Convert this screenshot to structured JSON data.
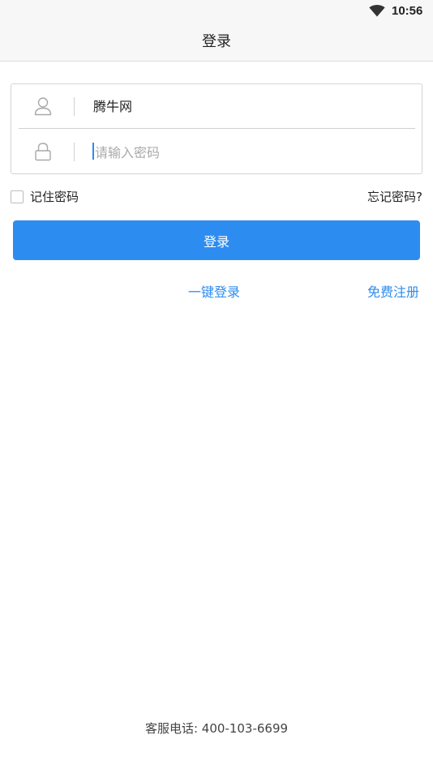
{
  "status_bar": {
    "time": "10:56",
    "wifi_icon": "wifi-icon"
  },
  "header": {
    "title": "登录"
  },
  "form": {
    "username_icon": "user-icon",
    "username_value": "腾牛网",
    "password_icon": "lock-icon",
    "password_placeholder": "请输入密码",
    "password_value": ""
  },
  "options": {
    "remember_label": "记住密码",
    "remember_checked": false,
    "forgot_label": "忘记密码?"
  },
  "actions": {
    "login_label": "登录",
    "one_click_label": "一键登录",
    "register_label": "免费注册"
  },
  "footer": {
    "service_phone": "客服电话: 400-103-6699"
  },
  "colors": {
    "accent": "#2d8cf0",
    "bar_background": "#f7f7f7",
    "border": "#d4d4d4"
  }
}
